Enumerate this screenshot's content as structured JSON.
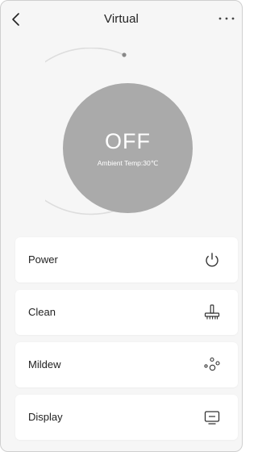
{
  "header": {
    "title": "Virtual",
    "back_icon": "chevron-left-icon",
    "more_icon": "more-horizontal-icon"
  },
  "dial": {
    "state": "OFF",
    "ambient": "Ambient Temp:30℃",
    "fill_color": "#aaaaaa",
    "ring_color": "#dddddd"
  },
  "controls": [
    {
      "label": "Power",
      "icon": "power-icon"
    },
    {
      "label": "Clean",
      "icon": "brush-icon"
    },
    {
      "label": "Mildew",
      "icon": "bubbles-icon"
    },
    {
      "label": "Display",
      "icon": "display-icon"
    }
  ]
}
